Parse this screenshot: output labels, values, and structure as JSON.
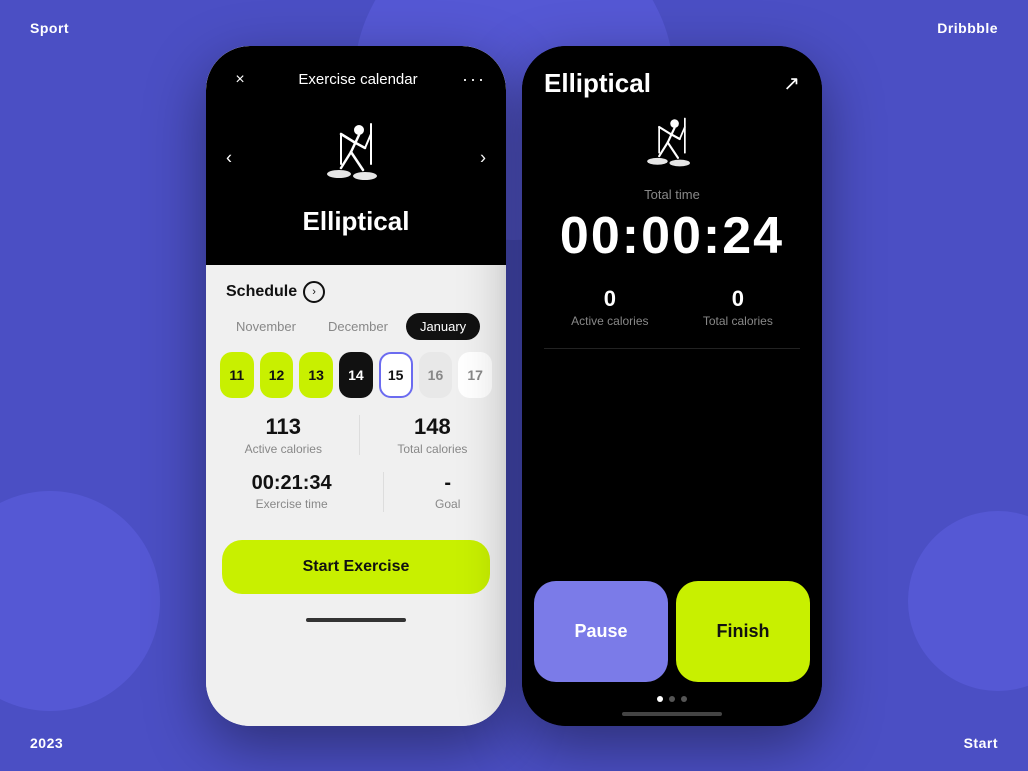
{
  "corner": {
    "top_left": "Sport",
    "top_right": "Dribbble",
    "bottom_left": "2023",
    "bottom_right": "Start"
  },
  "phone1": {
    "header": {
      "close_icon": "×",
      "title": "Exercise calendar",
      "more_icon": "···"
    },
    "exercise_name": "Elliptical",
    "nav": {
      "left": "‹",
      "right": "›"
    },
    "schedule": {
      "title": "Schedule",
      "months": [
        "November",
        "December",
        "January"
      ],
      "active_month": "January",
      "dates": [
        {
          "num": "11",
          "style": "green"
        },
        {
          "num": "12",
          "style": "green"
        },
        {
          "num": "13",
          "style": "green"
        },
        {
          "num": "14",
          "style": "black"
        },
        {
          "num": "15",
          "style": "outlined"
        },
        {
          "num": "16",
          "style": "light"
        },
        {
          "num": "17",
          "style": "white"
        }
      ]
    },
    "stats": {
      "active_calories": "113",
      "active_calories_label": "Active calories",
      "total_calories": "148",
      "total_calories_label": "Total calories"
    },
    "time": {
      "exercise_time": "00:21:34",
      "exercise_time_label": "Exercise time",
      "goal": "-",
      "goal_label": "Goal"
    },
    "start_button": "Start Exercise"
  },
  "phone2": {
    "title": "Elliptical",
    "external_link_icon": "↗",
    "total_time_label": "Total time",
    "timer": "00:00:24",
    "active_calories": "0",
    "active_calories_label": "Active calories",
    "total_calories": "0",
    "total_calories_label": "Total calories",
    "pause_button": "Pause",
    "finish_button": "Finish",
    "dots": [
      true,
      false,
      false
    ]
  }
}
